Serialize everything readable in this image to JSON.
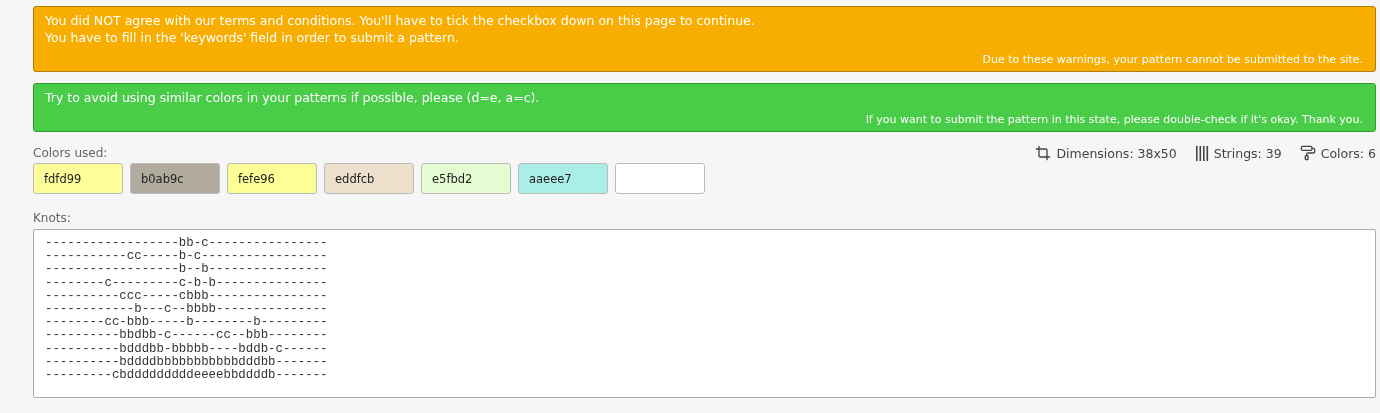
{
  "warning": {
    "lines": [
      "You did NOT agree with our terms and conditions. You'll have to tick the checkbox down on this page to continue.",
      "You have to fill in the 'keywords' field in order to submit a pattern."
    ],
    "note": "Due to these warnings, your pattern cannot be submitted to the site."
  },
  "notice": {
    "lines": [
      "Try to avoid using similar colors in your patterns if possible, please (d=e, a=c)."
    ],
    "note": "If you want to submit the pattern in this state, please double-check if it's okay. Thank you."
  },
  "colors_label": "Colors used:",
  "stats": [
    {
      "kind": "dimensions",
      "text": "Dimensions: 38x50"
    },
    {
      "kind": "strings",
      "text": "Strings: 39"
    },
    {
      "kind": "colors",
      "text": "Colors: 6"
    }
  ],
  "swatches": [
    {
      "label": "fdfd99",
      "color": "#fdfd99"
    },
    {
      "label": "b0ab9c",
      "color": "#b0ab9c"
    },
    {
      "label": "fefe96",
      "color": "#fefe96"
    },
    {
      "label": "eddfcb",
      "color": "#eddfcb"
    },
    {
      "label": "e5fbd2",
      "color": "#e5fbd2"
    },
    {
      "label": "aaeee7",
      "color": "#aaeee7"
    },
    {
      "color": "#ffffff"
    }
  ],
  "knots_label": "Knots:",
  "knots": [
    "------------------bb-c----------------",
    "-----------cc-----b-c-----------------",
    "------------------b--b----------------",
    "--------c---------c-b-b---------------",
    "----------ccc-----cbbb----------------",
    "------------b---c--bbbb---------------",
    "--------cc-bbb-----b--------b---------",
    "----------bbdbb-c------cc--bbb--------",
    "----------bdddbb-bbbbb----bddb-c------",
    "----------bddddbbbbbbbbbbbdddbb-------",
    "---------cbdddddddddeeeebbddddb-------"
  ]
}
